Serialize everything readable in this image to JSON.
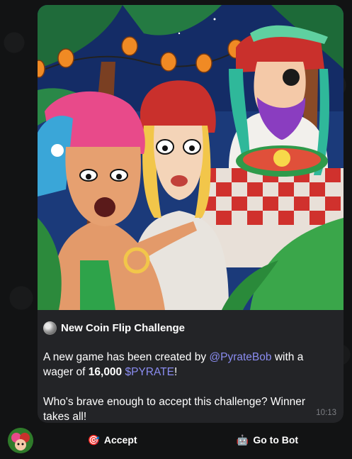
{
  "message": {
    "title": "New Coin Flip Challenge",
    "paragraph1": {
      "prefix": "A new game has been created by ",
      "mention": "@PyrateBob",
      "middle": " with a wager of ",
      "amount": "16,000",
      "space": " ",
      "token": "$PYRATE",
      "suffix": "!"
    },
    "paragraph2": "Who's brave enough to accept this challenge? Winner takes all!",
    "time": "10:13"
  },
  "buttons": {
    "accept": {
      "icon": "🎯",
      "label": "Accept"
    },
    "bot": {
      "icon": "🤖",
      "label": "Go to Bot"
    }
  },
  "colors": {
    "bubble": "#232427",
    "link": "#8a8cf0",
    "background": "#121314"
  },
  "icons": {
    "title_icon": "coin-icon",
    "accept_icon": "target-icon",
    "bot_icon": "robot-icon"
  }
}
